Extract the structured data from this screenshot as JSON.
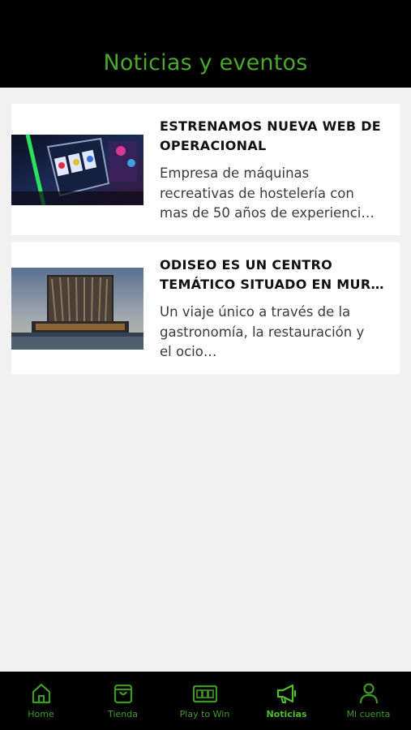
{
  "header": {
    "title": "Noticias y eventos"
  },
  "news": [
    {
      "title_line1": "ESTRENAMOS NUEVA WEB DE",
      "title_line2": "OPERACIONAL",
      "excerpt_line1": "Empresa de máquinas",
      "excerpt_line2": "recreativas de hostelería con",
      "excerpt_line3": "mas de 50 años de experienci…",
      "image": "slot-machines-photo"
    },
    {
      "title_line1": "ODISEO ES UN CENTRO",
      "title_line2": "TEMÁTICO SITUADO EN MUR…",
      "excerpt_line1": "Un viaje único a través de la",
      "excerpt_line2": "gastronomía, la restauración y",
      "excerpt_line3": "el ocio…",
      "image": "odiseo-building-photo"
    }
  ],
  "tabbar": {
    "tabs": [
      {
        "label": "Home",
        "icon": "home-icon"
      },
      {
        "label": "Tienda",
        "icon": "shopping-bag-icon"
      },
      {
        "label": "Play to Win",
        "icon": "slot-machine-icon"
      },
      {
        "label": "Noticias",
        "icon": "megaphone-icon",
        "active": true
      },
      {
        "label": "Mi cuenta",
        "icon": "user-icon"
      }
    ]
  },
  "colors": {
    "accent": "#4aa82f",
    "header_bg": "#000000",
    "page_bg": "#f1f1f1"
  }
}
